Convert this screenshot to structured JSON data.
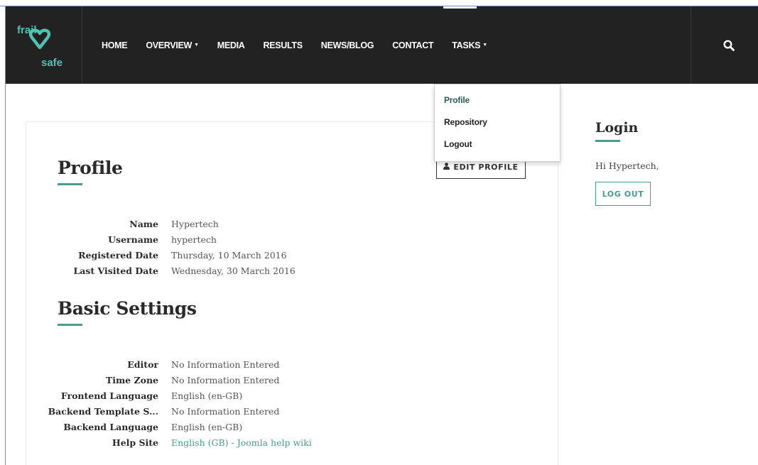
{
  "brand": {
    "logo_top": "frail",
    "logo_bottom": "safe",
    "accent_color": "#4a9c8c"
  },
  "nav": {
    "items": [
      {
        "label": "HOME",
        "has_caret": false
      },
      {
        "label": "OVERVIEW",
        "has_caret": true
      },
      {
        "label": "MEDIA",
        "has_caret": false
      },
      {
        "label": "RESULTS",
        "has_caret": false
      },
      {
        "label": "NEWS/BLOG",
        "has_caret": false
      },
      {
        "label": "CONTACT",
        "has_caret": false
      },
      {
        "label": "TASKS",
        "has_caret": true
      }
    ],
    "search_icon": "search-icon"
  },
  "tasks_menu": {
    "items": [
      "Profile",
      "Repository",
      "Logout"
    ]
  },
  "profile": {
    "title": "Profile",
    "edit_label": "EDIT PROFILE",
    "fields": [
      {
        "label": "Name",
        "value": "Hypertech"
      },
      {
        "label": "Username",
        "value": "hypertech"
      },
      {
        "label": "Registered Date",
        "value": "Thursday, 10 March 2016"
      },
      {
        "label": "Last Visited Date",
        "value": "Wednesday, 30 March 2016"
      }
    ]
  },
  "basic_settings": {
    "title": "Basic Settings",
    "fields": [
      {
        "label": "Editor",
        "value": "No Information Entered"
      },
      {
        "label": "Time Zone",
        "value": "No Information Entered"
      },
      {
        "label": "Frontend Language",
        "value": "English (en-GB)"
      },
      {
        "label": "Backend Template S...",
        "value": "No Information Entered"
      },
      {
        "label": "Backend Language",
        "value": "English (en-GB)"
      },
      {
        "label": "Help Site",
        "value": "English (GB) - Joomla help wiki"
      }
    ]
  },
  "login": {
    "title": "Login",
    "greeting": "Hi Hypertech,",
    "logout_label": "LOG OUT"
  }
}
